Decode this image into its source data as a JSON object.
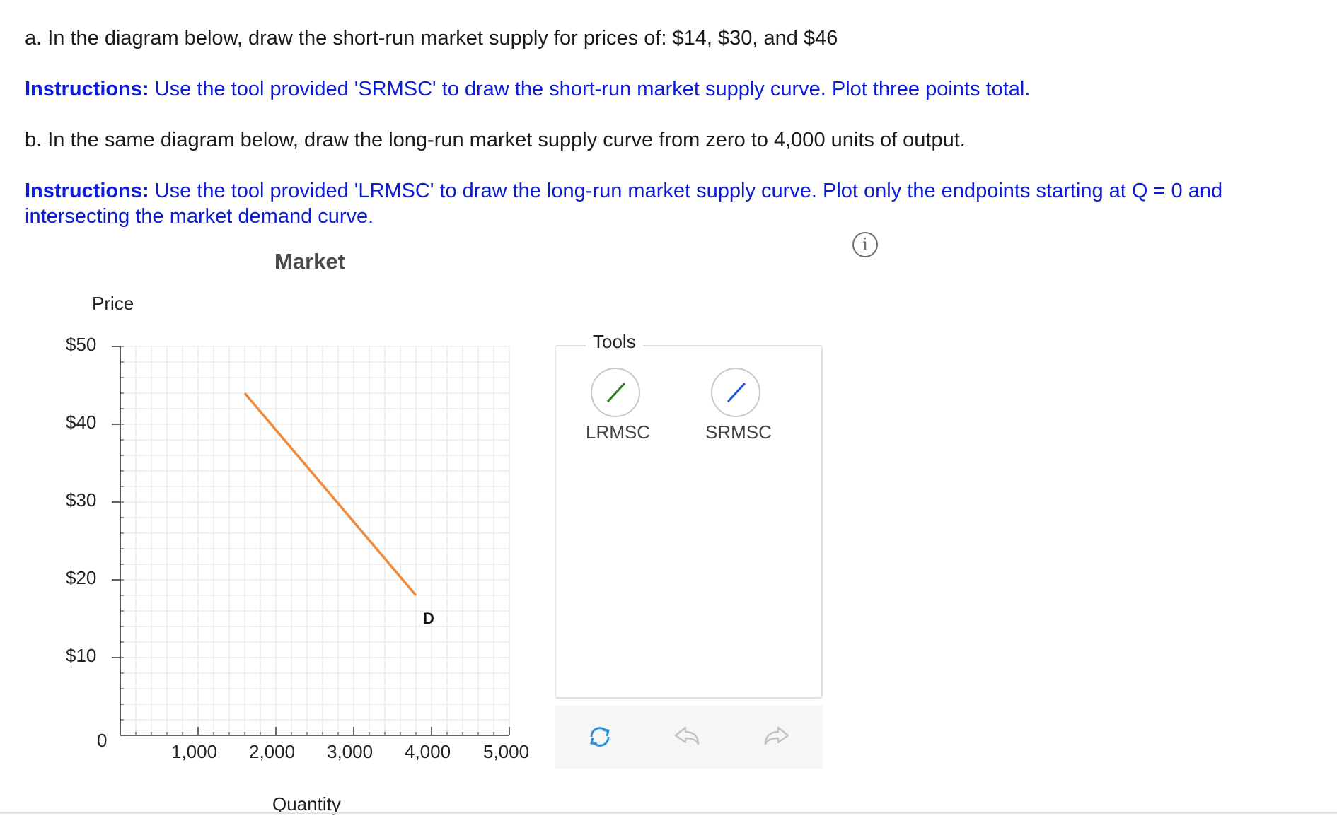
{
  "question_a": "a. In the diagram below, draw the short-run market supply for prices of: $14, $30, and $46",
  "instructions_a": {
    "bold": "Instructions:",
    "text": " Use the tool provided 'SRMSC' to draw the short-run market supply curve. Plot three points total."
  },
  "question_b": "b. In the same diagram below, draw the long-run market supply curve from zero to 4,000 units of output.",
  "instructions_b": {
    "bold": "Instructions:",
    "text": " Use the tool provided 'LRMSC' to draw the long-run market supply curve. Plot only the endpoints starting at Q = 0 and intersecting the market demand curve."
  },
  "info_icon": "i",
  "chart_data": {
    "type": "line",
    "title": "Market",
    "ylabel": "Price",
    "xlabel": "Quantity",
    "xlim": [
      0,
      5000
    ],
    "ylim": [
      0,
      50
    ],
    "x_ticks": [
      "1,000",
      "2,000",
      "3,000",
      "4,000",
      "5,000"
    ],
    "y_ticks": [
      "$50",
      "$40",
      "$30",
      "$20",
      "$10",
      "0"
    ],
    "grid": true,
    "series": [
      {
        "name": "D",
        "color": "#f08a3c",
        "points": [
          [
            1600,
            44
          ],
          [
            3800,
            18
          ]
        ]
      }
    ]
  },
  "tools": {
    "title": "Tools",
    "items": [
      {
        "label": "LRMSC",
        "color": "#2e7d1e",
        "icon": "line-tool-icon"
      },
      {
        "label": "SRMSC",
        "color": "#1f56d8",
        "icon": "line-tool-icon"
      }
    ]
  },
  "actions": {
    "reset_icon": "reset-icon",
    "undo_icon": "undo-icon",
    "redo_icon": "redo-icon",
    "reset_color": "#2a8fd6"
  }
}
